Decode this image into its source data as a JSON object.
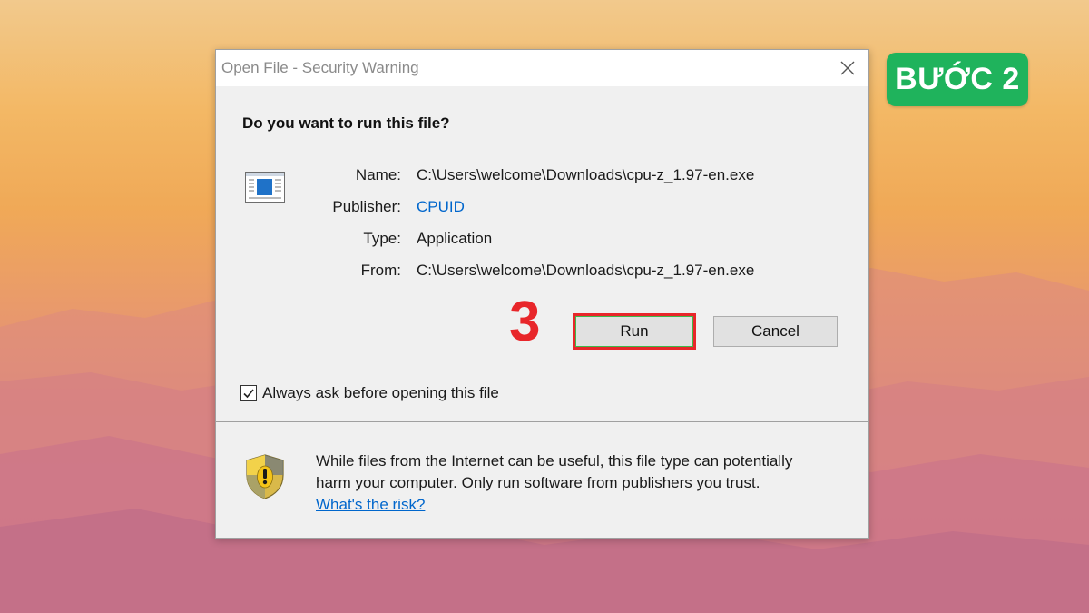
{
  "badge": {
    "label": "BƯỚC 2"
  },
  "dialog": {
    "title": "Open File - Security Warning",
    "question": "Do you want to run this file?",
    "fields": [
      {
        "label": "Name:",
        "value": "C:\\Users\\welcome\\Downloads\\cpu-z_1.97-en.exe"
      },
      {
        "label": "Publisher:",
        "value": "CPUID"
      },
      {
        "label": "Type:",
        "value": "Application"
      },
      {
        "label": "From:",
        "value": "C:\\Users\\welcome\\Downloads\\cpu-z_1.97-en.exe"
      }
    ],
    "step_number": "3",
    "buttons": {
      "run": "Run",
      "cancel": "Cancel"
    },
    "checkbox": {
      "label": "Always ask before opening this file",
      "checked": true
    },
    "warning": {
      "line1": "While files from the Internet can be useful, this file type can potentially",
      "line2": "harm your computer. Only run software from publishers you trust.",
      "link": "What's the risk?"
    }
  },
  "icons": {
    "close": "close-icon",
    "file": "application-file-icon",
    "shield": "shield-warning-icon",
    "check": "checkmark-icon"
  },
  "colors": {
    "badge_green": "#1fb35c",
    "highlight_red": "#e8262a",
    "link_blue": "#0066cc"
  }
}
